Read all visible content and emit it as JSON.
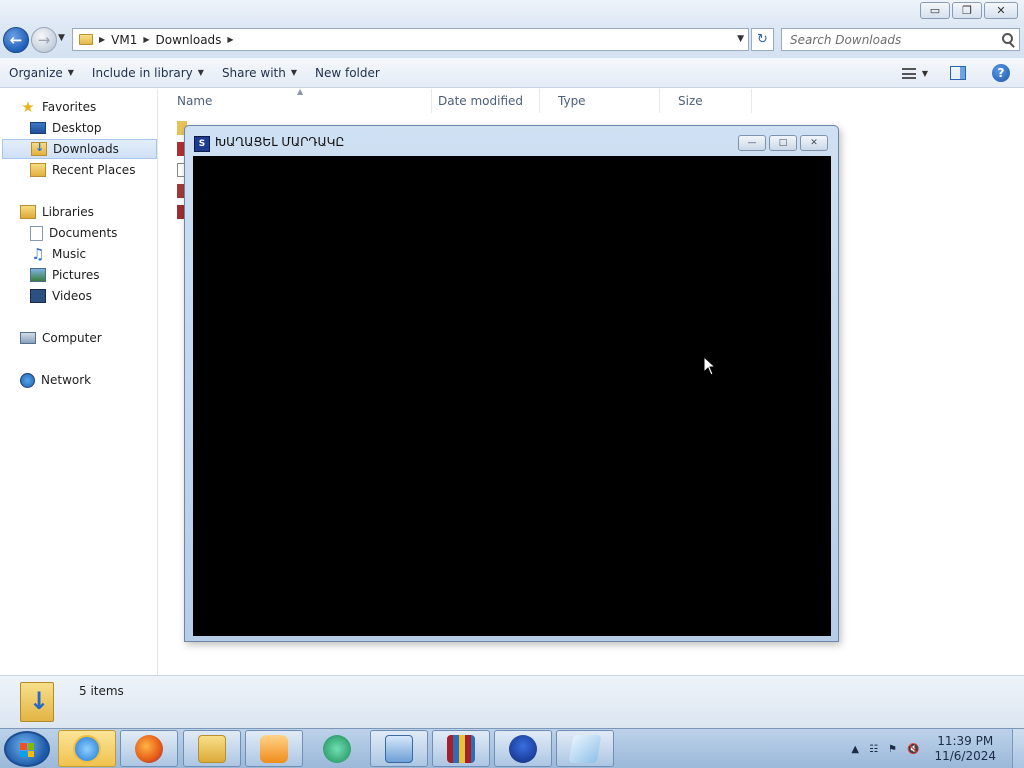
{
  "explorer": {
    "window_buttons": {
      "minimize": "▭",
      "restore": "❐",
      "close": "✕"
    },
    "address": {
      "breadcrumbs": [
        "VM1",
        "Downloads"
      ]
    },
    "search": {
      "placeholder": "Search Downloads"
    },
    "toolbar": {
      "organize": "Organize",
      "include_in_library": "Include in library",
      "share_with": "Share with",
      "new_folder": "New folder"
    },
    "nav": {
      "favorites_label": "Favorites",
      "favorites": [
        "Desktop",
        "Downloads",
        "Recent Places"
      ],
      "libraries_label": "Libraries",
      "libraries": [
        "Documents",
        "Music",
        "Pictures",
        "Videos"
      ],
      "computer": "Computer",
      "network": "Network",
      "selected": "Downloads"
    },
    "columns": {
      "name": "Name",
      "date_modified": "Date modified",
      "type": "Type",
      "size": "Size"
    },
    "details": {
      "item_count": "5 items"
    }
  },
  "app_window": {
    "title": "ԽԱՂԱՑԵԼ ՄԱՐԴԱԿԸ",
    "icon": "sonic-icon",
    "buttons": {
      "minimize": "—",
      "maximize": "□",
      "close": "✕"
    }
  },
  "taskbar": {
    "apps": [
      {
        "name": "internet-explorer",
        "active": true
      },
      {
        "name": "firefox"
      },
      {
        "name": "file-explorer"
      },
      {
        "name": "media-player"
      },
      {
        "name": "app-green-circle"
      },
      {
        "name": "control-panel"
      },
      {
        "name": "winrar"
      },
      {
        "name": "sonic-game"
      },
      {
        "name": "notepad-app"
      }
    ],
    "clock": {
      "time": "11:39 PM",
      "date": "11/6/2024"
    }
  }
}
